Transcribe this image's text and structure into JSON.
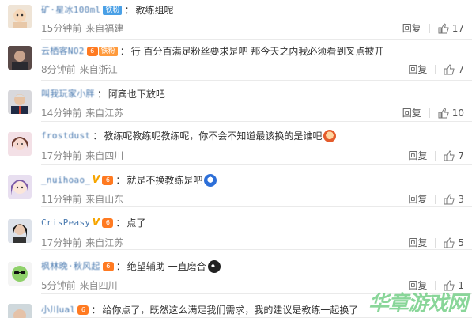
{
  "comments": [
    {
      "username": "矿·星冰100ml",
      "badge": "铁粉",
      "text": "教练组呢",
      "time": "15分钟前",
      "location": "来自福建",
      "reply": "回复",
      "likes": "17"
    },
    {
      "username": "云栖客NO2",
      "level": "6",
      "badge": "铁粉",
      "text": "行 百分百满足粉丝要求是吧 那今天之内我必须看到叉点披开",
      "time": "8分钟前",
      "location": "来自浙江",
      "reply": "回复",
      "likes": "7"
    },
    {
      "username": "叫我玩家小胖",
      "text": "阿宾也下放吧",
      "time": "14分钟前",
      "location": "来自江苏",
      "reply": "回复",
      "likes": "10"
    },
    {
      "username": "frostdust",
      "text": "教练呢教练呢教练呢，你不会不知道最该换的是谁吧",
      "time": "17分钟前",
      "location": "来自四川",
      "reply": "回复",
      "likes": "7"
    },
    {
      "username": "_nuihoao_",
      "level": "6",
      "text": "就是不换教练是吧",
      "time": "11分钟前",
      "location": "来自山东",
      "reply": "回复",
      "likes": "3"
    },
    {
      "username": "CrisPeasy",
      "level": "6",
      "text": "点了",
      "time": "17分钟前",
      "location": "来自江苏",
      "reply": "回复",
      "likes": "5"
    },
    {
      "username": "枫林晚·秋风起",
      "level": "6",
      "text": "绝望辅助 一直磨合",
      "time": "5分钟前",
      "location": "来自四川",
      "reply": "回复",
      "likes": "1"
    },
    {
      "username": "小川ual",
      "level": "6",
      "text": "给你点了，既然这么满足我们需求，我的建议是教练一起换了",
      "time": "",
      "location": "",
      "reply": "",
      "likes": ""
    }
  ],
  "watermark": "华章游戏网",
  "colors": {
    "username": "#4a7ab0",
    "badge": "#4aa0e6",
    "level": "#ff7a21",
    "meta": "#888888"
  }
}
